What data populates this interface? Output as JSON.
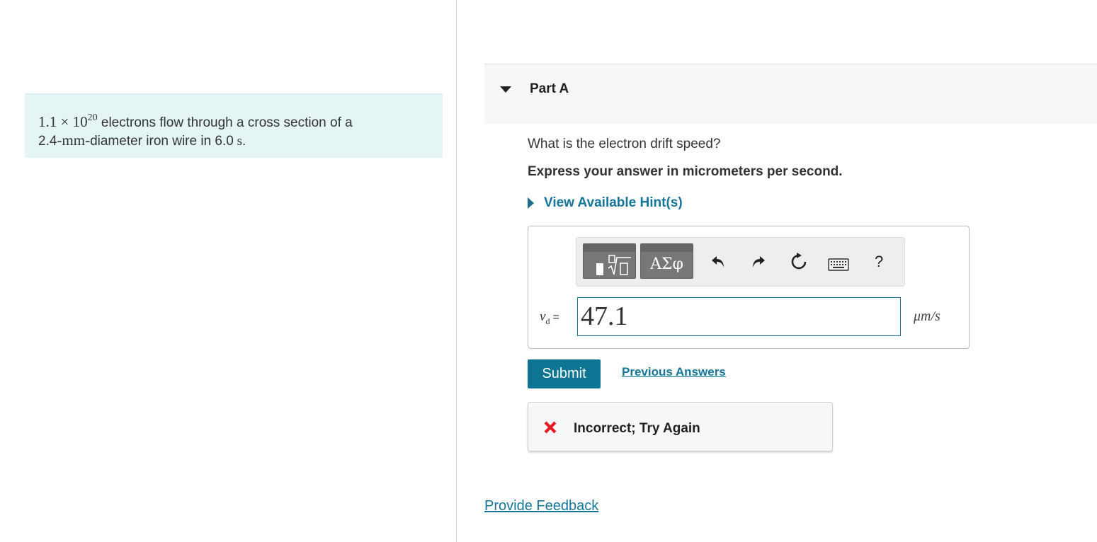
{
  "problem": {
    "coefficient": "1.1",
    "times_sign": "×",
    "base": "10",
    "exponent": "20",
    "text_line1": " electrons flow through a cross section of a",
    "diameter_value": "2.4",
    "diameter_unit": "-mm-",
    "text_line2": "diameter iron wire in ",
    "time_value": "6.0",
    "time_unit": " s",
    "period": "."
  },
  "part": {
    "title": "Part A",
    "question": "What is the electron drift speed?",
    "instruction": "Express your answer in micrometers per second.",
    "hints_label": "View Available Hint(s)"
  },
  "toolbar": {
    "symbols_label": "ΑΣφ",
    "help_label": "?",
    "icons": [
      "templates-icon",
      "greek-symbols-icon",
      "undo-icon",
      "redo-icon",
      "reset-icon",
      "keyboard-icon",
      "help-icon"
    ]
  },
  "answer": {
    "variable": "v",
    "subscript": "d",
    "equals": "=",
    "value": "47.1",
    "unit": "μm/s"
  },
  "actions": {
    "submit_label": "Submit",
    "previous_answers_label": "Previous Answers"
  },
  "feedback": {
    "status": "Incorrect; Try Again",
    "status_color": "#e41b23"
  },
  "footer": {
    "provide_feedback_label": "Provide Feedback"
  },
  "colors": {
    "accent": "#0d7593",
    "link": "#15769a",
    "problem_bg": "#e5f5f6"
  }
}
